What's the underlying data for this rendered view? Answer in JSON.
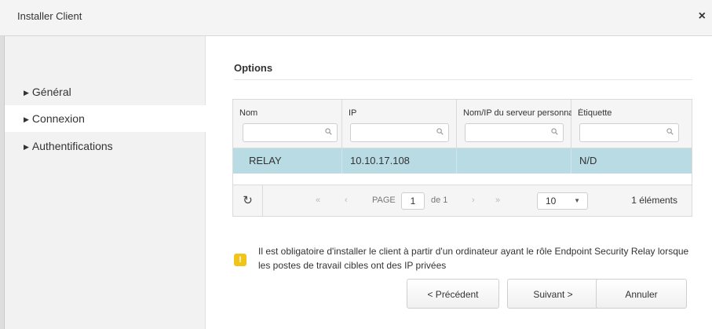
{
  "window": {
    "title": "Installer Client",
    "close_glyph": "×"
  },
  "sidebar": {
    "items": [
      {
        "label": "Général",
        "active": false
      },
      {
        "label": "Connexion",
        "active": true
      },
      {
        "label": "Authentifications",
        "active": false
      }
    ],
    "arrow_glyph": "▶"
  },
  "options": {
    "title": "Options"
  },
  "grid": {
    "columns": [
      {
        "label": "Nom"
      },
      {
        "label": "IP"
      },
      {
        "label": "Nom/IP du serveur personnalisé"
      },
      {
        "label": "Étiquette"
      }
    ],
    "filters": [
      "",
      "",
      "",
      ""
    ],
    "rows": [
      {
        "nom": "RELAY",
        "ip": "10.10.17.108",
        "serveur": "",
        "etiquette": "N/D"
      }
    ],
    "selected_row_color": "#b9dbe4"
  },
  "pager": {
    "refresh_icon": "↻",
    "first": "«",
    "prev": "‹",
    "page_label": "PAGE",
    "page_value": "1",
    "of_label": "de 1",
    "next": "›",
    "last": "»",
    "page_size": "10",
    "dropdown_glyph": "▼",
    "count_label": "1 éléments"
  },
  "warning": {
    "icon": "!",
    "color": "#f0c419",
    "text": "Il est obligatoire d'installer le client à partir d'un ordinateur ayant le rôle Endpoint Security Relay lorsque les postes de travail cibles ont des IP privées"
  },
  "buttons": {
    "previous": "< Précédent",
    "next": "Suivant >",
    "cancel": "Annuler"
  }
}
